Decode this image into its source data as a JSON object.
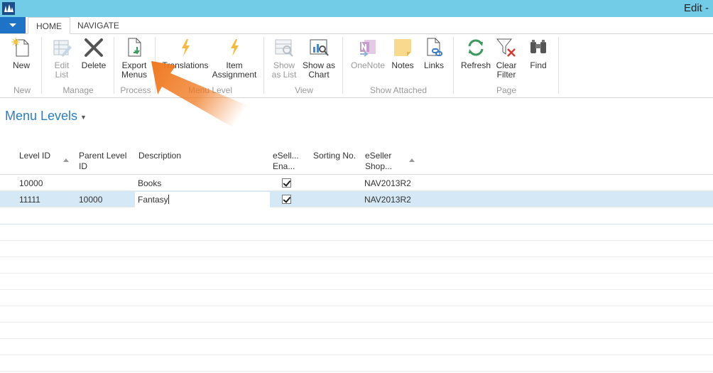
{
  "titlebar": {
    "title": "Edit -"
  },
  "tabs": [
    {
      "label": "HOME"
    },
    {
      "label": "NAVIGATE"
    }
  ],
  "ribbon": {
    "groups": {
      "new": "New",
      "manage": "Manage",
      "process": "Process",
      "menu_level": "Menu Level",
      "view": "View",
      "show_attached": "Show Attached",
      "page": "Page"
    },
    "buttons": {
      "new": "New",
      "edit_list_1": "Edit",
      "edit_list_2": "List",
      "delete": "Delete",
      "export_menus_1": "Export",
      "export_menus_2": "Menus",
      "translations": "Translations",
      "item_assignment_1": "Item",
      "item_assignment_2": "Assignment",
      "show_as_list_1": "Show",
      "show_as_list_2": "as List",
      "show_as_chart_1": "Show as",
      "show_as_chart_2": "Chart",
      "onenote": "OneNote",
      "notes": "Notes",
      "links": "Links",
      "refresh": "Refresh",
      "clear_filter_1": "Clear",
      "clear_filter_2": "Filter",
      "find": "Find"
    }
  },
  "page": {
    "title": "Menu Levels"
  },
  "columns": {
    "level_id": "Level ID",
    "parent_level_1": "Parent Level",
    "parent_level_2": "ID",
    "description": "Description",
    "eseller_enabled_1": "eSell...",
    "eseller_enabled_2": "Ena...",
    "sorting_no": "Sorting No.",
    "eseller_shop_1": "eSeller",
    "eseller_shop_2": "Shop..."
  },
  "rows": [
    {
      "level_id": "10000",
      "parent_level_id": "",
      "description": "Books",
      "enabled": true,
      "shop": "NAV2013R2"
    },
    {
      "level_id": "11111",
      "parent_level_id": "10000",
      "description": "Fantasy",
      "enabled": true,
      "shop": "NAV2013R2"
    }
  ],
  "colors": {
    "titlebar": "#72cce8",
    "accent": "#1e73c6",
    "selected_row": "#d5e8f6",
    "page_title": "#2a7fc1",
    "annotation_arrow": "#f07a22"
  }
}
